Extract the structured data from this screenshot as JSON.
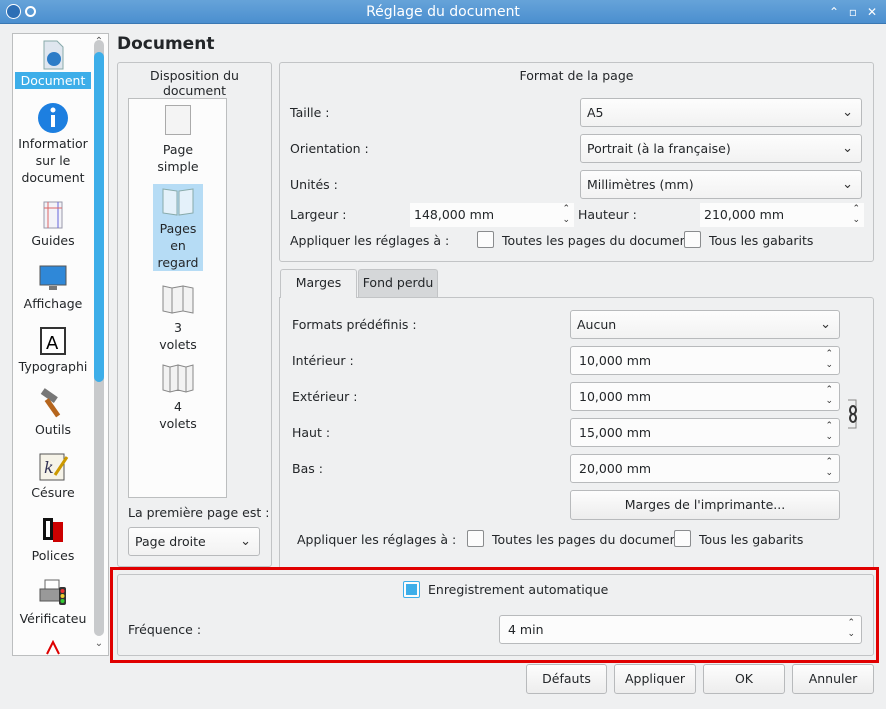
{
  "window": {
    "title": "Réglage du document"
  },
  "sidebar": {
    "items": [
      {
        "label": "Document",
        "icon": "document-icon"
      },
      {
        "label": "Informatior sur le document",
        "icon": "info-icon"
      },
      {
        "label": "Guides",
        "icon": "guides-icon"
      },
      {
        "label": "Affichage",
        "icon": "display-monitor-icon"
      },
      {
        "label": "Typographi",
        "icon": "typography-icon"
      },
      {
        "label": "Outils",
        "icon": "hammer-icon"
      },
      {
        "label": "Césure",
        "icon": "hyphenation-icon"
      },
      {
        "label": "Polices",
        "icon": "fonts-icon"
      },
      {
        "label": "Vérificateu",
        "icon": "printer-preflight-icon"
      }
    ]
  },
  "heading": "Document",
  "layout": {
    "title": "Disposition du document",
    "items": [
      {
        "line1": "Page",
        "line2": "simple"
      },
      {
        "line1": "Pages",
        "line2": "en",
        "line3": "regard"
      },
      {
        "line1": "3",
        "line2": "volets"
      },
      {
        "line1": "4",
        "line2": "volets"
      }
    ],
    "first_page_label": "La première page est :",
    "first_page_value": "Page droite"
  },
  "format": {
    "title": "Format de la page",
    "size_label": "Taille :",
    "size_value": "A5",
    "orientation_label": "Orientation :",
    "orientation_value": "Portrait (à la française)",
    "units_label": "Unités :",
    "units_value": "Millimètres (mm)",
    "width_label": "Largeur :",
    "width_value": "148,000 mm",
    "height_label": "Hauteur :",
    "height_value": "210,000 mm",
    "apply_label": "Appliquer les réglages à :",
    "all_pages": "Toutes les pages du document",
    "all_masters": "Tous les gabarits"
  },
  "tabs": {
    "margins": "Marges",
    "bleed": "Fond perdu"
  },
  "margins": {
    "presets_label": "Formats prédéfinis :",
    "presets_value": "Aucun",
    "inner_label": "Intérieur :",
    "inner_value": "10,000 mm",
    "outer_label": "Extérieur :",
    "outer_value": "10,000 mm",
    "top_label": "Haut :",
    "top_value": "15,000 mm",
    "bottom_label": "Bas :",
    "bottom_value": "20,000 mm",
    "printer_margins": "Marges de l'imprimante...",
    "apply_label": "Appliquer les réglages à :",
    "all_pages": "Toutes les pages du document",
    "all_masters": "Tous les gabarits"
  },
  "autosave": {
    "label": "Enregistrement automatique",
    "checked": true,
    "freq_label": "Fréquence :",
    "freq_value": "4 min"
  },
  "buttons": {
    "defaults": "Défauts",
    "apply": "Appliquer",
    "ok": "OK",
    "cancel": "Annuler"
  },
  "colors": {
    "accent": "#3daee9",
    "highlight": "#e00000",
    "titlebar": "#4b8fcf"
  }
}
